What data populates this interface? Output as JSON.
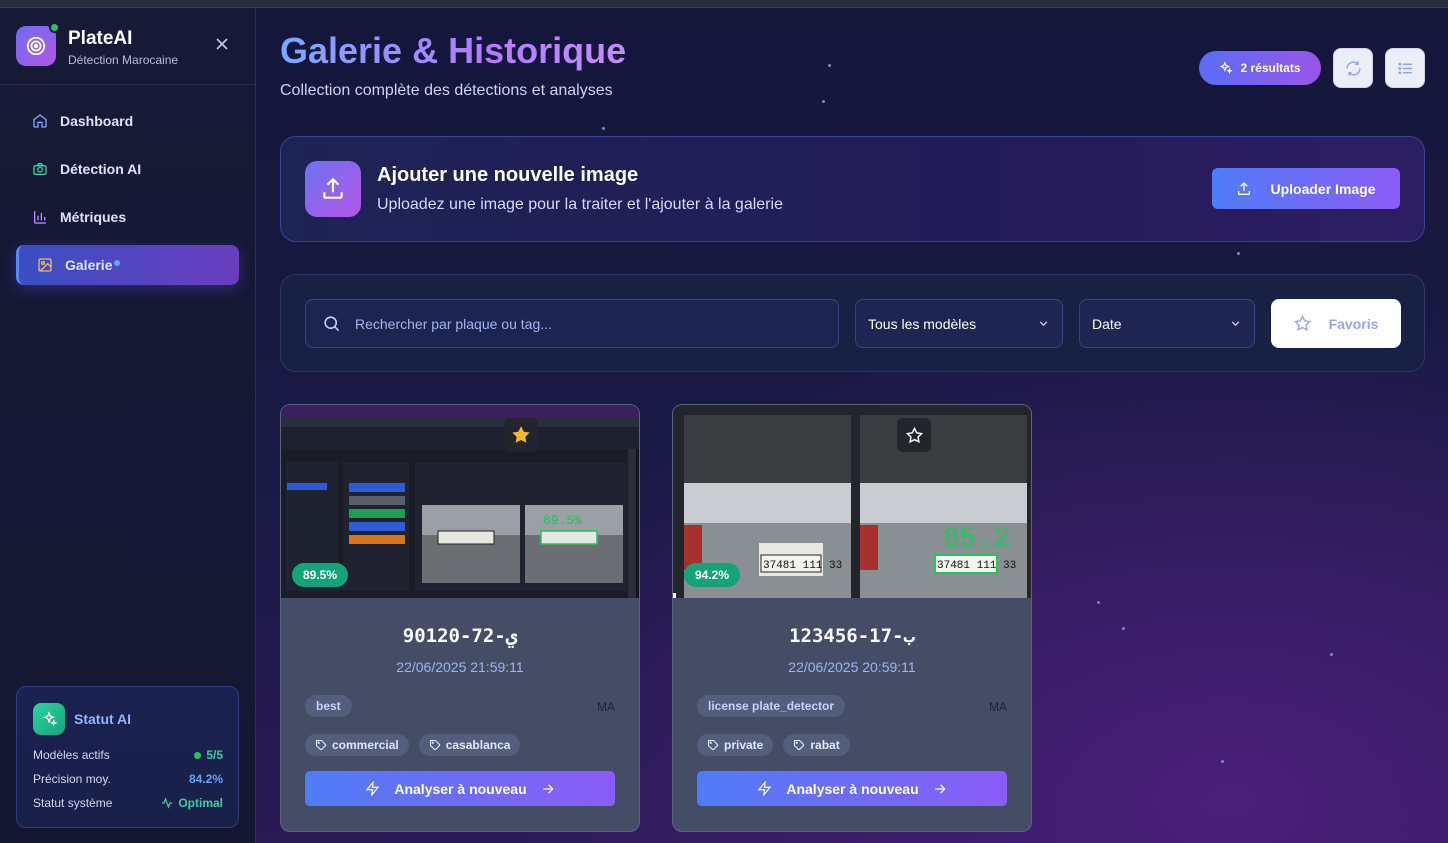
{
  "brand": {
    "name": "PlateAI",
    "subtitle": "Détection Marocaine"
  },
  "nav": {
    "items": [
      {
        "label": "Dashboard",
        "icon": "home-icon"
      },
      {
        "label": "Détection AI",
        "icon": "camera-icon"
      },
      {
        "label": "Métriques",
        "icon": "bar-chart-icon"
      },
      {
        "label": "Galerie",
        "icon": "image-icon",
        "active": true
      }
    ]
  },
  "status": {
    "title": "Statut AI",
    "rows": [
      {
        "label": "Modèles actifs",
        "value": "5/5"
      },
      {
        "label": "Précision moy.",
        "value": "84.2%"
      },
      {
        "label": "Statut système",
        "value": "Optimal"
      }
    ]
  },
  "header": {
    "title": "Galerie & Historique",
    "subtitle": "Collection complète des détections et analyses",
    "results_label": "2 résultats"
  },
  "upload": {
    "title": "Ajouter une nouvelle image",
    "subtitle": "Uploadez une image pour la traiter et l'ajouter à la galerie",
    "button_label": "Uploader Image"
  },
  "filters": {
    "search_placeholder": "Rechercher par plaque ou tag...",
    "model_select": "Tous les modèles",
    "date_select": "Date",
    "favorites_label": "Favoris"
  },
  "cards": [
    {
      "plate": "90120-72-ي",
      "date": "22/06/2025 21:59:11",
      "confidence": "89.5%",
      "model": "best",
      "country": "MA",
      "tags": [
        "commercial",
        "casablanca"
      ],
      "favorite": true,
      "action_label": "Analyser à nouveau"
    },
    {
      "plate": "123456-17-ب",
      "date": "22/06/2025 20:59:11",
      "confidence": "94.2%",
      "model": "license plate_detector",
      "country": "MA",
      "tags": [
        "private",
        "rabat"
      ],
      "favorite": false,
      "action_label": "Analyser à nouveau"
    }
  ],
  "colors": {
    "accent_gradient_start": "#4f7cf7",
    "accent_gradient_end": "#8b5cf6",
    "success": "#16a37a",
    "favorite_star": "#f5b82e"
  }
}
